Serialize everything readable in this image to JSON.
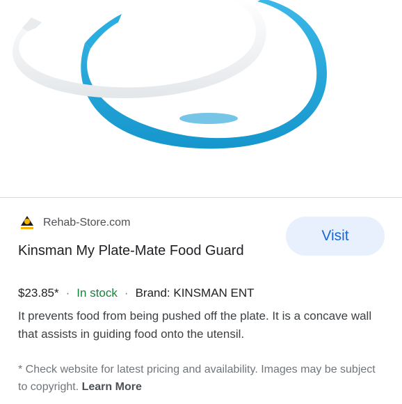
{
  "product": {
    "image_icon": "product-image",
    "source": {
      "logo_icon": "rehab-store-logo-icon",
      "name": "Rehab-Store.com"
    },
    "visit_label": "Visit",
    "title": "Kinsman My Plate-Mate Food Guard",
    "price": "$23.85*",
    "separator": "·",
    "stock": "In stock",
    "brand": "Brand: KINSMAN ENT",
    "description": "It prevents food from being pushed off the plate. It is a concave wall that assists in guiding food onto the utensil.",
    "disclaimer": "* Check website for latest pricing and availability. Images may be subject to copyright.",
    "learn_more": "Learn More"
  },
  "colors": {
    "stock_green": "#188038",
    "visit_bg": "#e8f0fe",
    "visit_text": "#1967d2",
    "guard_blue": "#1aa3d9",
    "guard_white": "#f2f4f5"
  }
}
